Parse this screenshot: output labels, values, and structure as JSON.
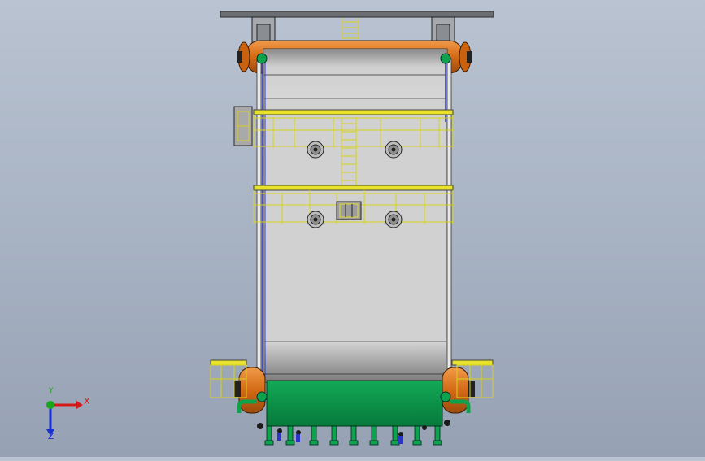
{
  "viewport": {
    "background_top": "#b9c3d1",
    "background_bottom": "#96a1b3"
  },
  "model": {
    "colors": {
      "shell": "#c9c9c9",
      "shell_dark": "#7a7a7a",
      "platform": "#e8e22a",
      "tank": "#d9741c",
      "base": "#0b9a4e",
      "nozzle_green": "#0fa24c",
      "pipe_blue": "#2a35c8",
      "top_plate": "#6b6e73"
    }
  },
  "triad": {
    "x_label": "X",
    "y_label": "Y",
    "z_label": "Z",
    "x_icon": "axis-x-arrow-icon",
    "y_icon": "axis-y-arrow-icon",
    "z_icon": "axis-z-arrow-icon"
  }
}
